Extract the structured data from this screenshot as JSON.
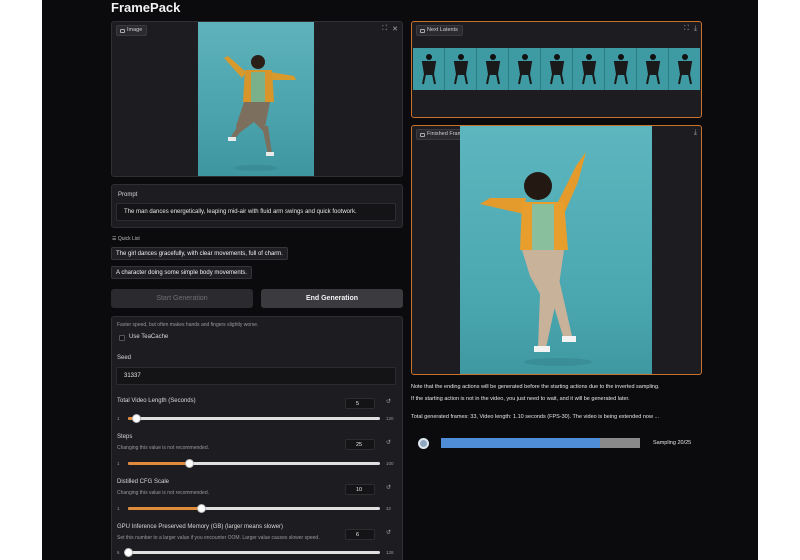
{
  "app": {
    "title": "FramePack"
  },
  "image_panel": {
    "label": "Image"
  },
  "next_latents": {
    "label": "Next Latents"
  },
  "finished_frames": {
    "label": "Finished Frames"
  },
  "prompt": {
    "label": "Prompt",
    "value": "The man dances energetically, leaping mid-air with fluid arm swings and quick footwork."
  },
  "quick_list": {
    "label": "Quick List",
    "items": [
      "The girl dances gracefully, with clear movements, full of charm.",
      "A character doing some simple body movements."
    ]
  },
  "buttons": {
    "start": "Start Generation",
    "end": "End Generation"
  },
  "teacache": {
    "info": "Faster speed, but often makes hands and fingers slightly worse.",
    "label": "Use TeaCache"
  },
  "seed": {
    "label": "Seed",
    "value": "31337"
  },
  "video_length": {
    "label": "Total Video Length (Seconds)",
    "value": "5",
    "min": "1",
    "max": "120",
    "level": 5
  },
  "steps": {
    "label": "Steps",
    "info": "Changing this value is not recommended.",
    "value": "25",
    "min": "1",
    "max": "100",
    "level": 25
  },
  "cfg": {
    "label": "Distilled CFG Scale",
    "info": "Changing this value is not recommended.",
    "value": "10",
    "min": "1",
    "max": "32",
    "level": 10
  },
  "gpu_memory": {
    "label": "GPU Inference Preserved Memory (GB) (larger means slower)",
    "info": "Set this number to a larger value if you encounter OOM. Larger value causes slower speed.",
    "value": "6",
    "min": "6",
    "max": "128",
    "level": 6
  },
  "notes": {
    "line1": "Note that the ending actions will be generated before the starting actions due to the inverted sampling.",
    "line2": "If the starting action is not in the video, you just need to wait, and it will be generated later.",
    "line3": "Total generated frames: 33, Video length: 1.10 seconds (FPS-30). The video is being extended now ..."
  },
  "progress": {
    "label": "Sampling 20/25",
    "percent": 80
  },
  "icons": {
    "image_tag": "image-icon",
    "fullscreen": "fullscreen-icon",
    "close": "close-icon",
    "download": "download-icon",
    "reset": "reset-icon",
    "list": "list-icon"
  },
  "colors": {
    "accent": "#e08a3c",
    "progress": "#4f8dd6",
    "border_active": "#c9722e"
  }
}
